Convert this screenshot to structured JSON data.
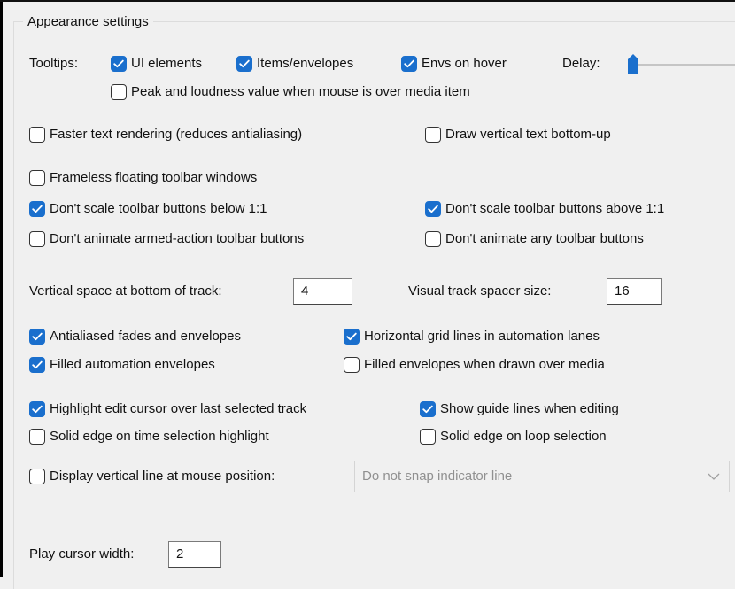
{
  "group_title": "Appearance settings",
  "tooltips": {
    "label": "Tooltips:",
    "ui_elements": {
      "label": "UI elements",
      "checked": true
    },
    "items_envelopes": {
      "label": "Items/envelopes",
      "checked": true
    },
    "envs_on_hover": {
      "label": "Envs on hover",
      "checked": true
    },
    "delay_label": "Delay:",
    "delay_value_fraction": 0.0,
    "peak_loudness": {
      "label": "Peak and loudness value when mouse is over media item",
      "checked": false
    }
  },
  "text_options": {
    "faster_text": {
      "label": "Faster text rendering (reduces antialiasing)",
      "checked": false
    },
    "vertical_text": {
      "label": "Draw vertical text bottom-up",
      "checked": false
    }
  },
  "toolbar_options": {
    "frameless": {
      "label": "Frameless floating toolbar windows",
      "checked": false
    },
    "no_scale_below": {
      "label": "Don't scale toolbar buttons below 1:1",
      "checked": true
    },
    "no_scale_above": {
      "label": "Don't scale toolbar buttons above 1:1",
      "checked": true
    },
    "no_animate_armed": {
      "label": "Don't animate armed-action toolbar buttons",
      "checked": false
    },
    "no_animate_any": {
      "label": "Don't animate any toolbar buttons",
      "checked": false
    }
  },
  "track_spacing": {
    "vertical_space_label": "Vertical space at bottom of track:",
    "vertical_space_value": "4",
    "spacer_size_label": "Visual track spacer size:",
    "spacer_size_value": "16"
  },
  "envelope_options": {
    "antialiased": {
      "label": "Antialiased fades and envelopes",
      "checked": true
    },
    "grid_lines": {
      "label": "Horizontal grid lines in automation lanes",
      "checked": true
    },
    "filled_auto": {
      "label": "Filled automation envelopes",
      "checked": true
    },
    "filled_over_media": {
      "label": "Filled envelopes when drawn over media",
      "checked": false
    }
  },
  "cursor_options": {
    "highlight_cursor": {
      "label": "Highlight edit cursor over last selected track",
      "checked": true
    },
    "guide_lines": {
      "label": "Show guide lines when editing",
      "checked": true
    },
    "solid_time": {
      "label": "Solid edge on time selection highlight",
      "checked": false
    },
    "solid_loop": {
      "label": "Solid edge on loop selection",
      "checked": false
    }
  },
  "mouse_line": {
    "label": "Display vertical line at mouse position:",
    "checked": false,
    "snap_selected": "Do not snap indicator line"
  },
  "play_cursor": {
    "label": "Play cursor width:",
    "value": "2"
  },
  "icons": {
    "check": "check-icon",
    "dropdown": "chevron-down-icon",
    "slider": "slider-thumb"
  },
  "colors": {
    "checked_fill": "#1a6fcd",
    "background": "#f0f0f0"
  }
}
